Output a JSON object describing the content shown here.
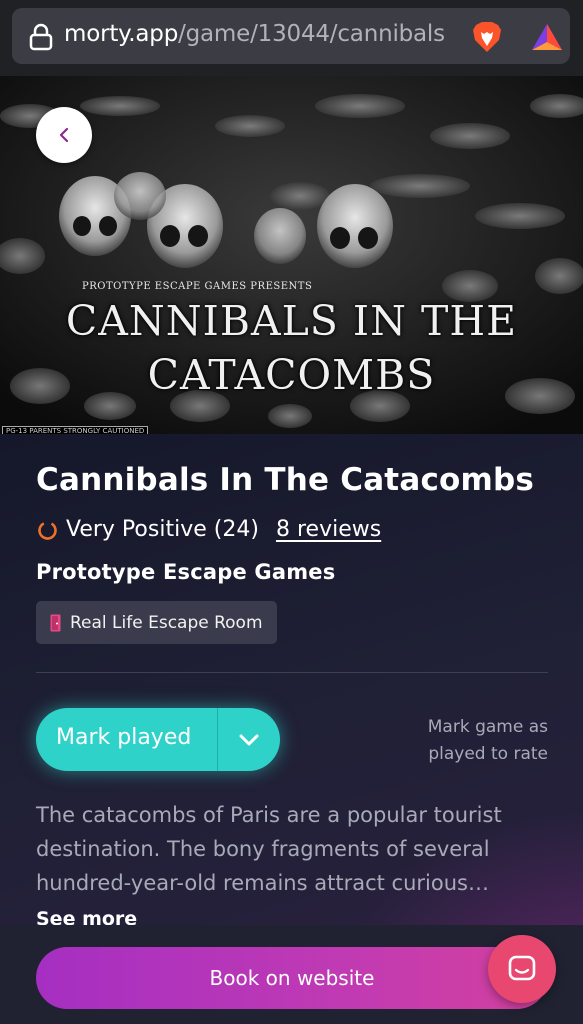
{
  "browser": {
    "url_host": "morty.app",
    "url_path": "/game/13044/cannibals"
  },
  "hero": {
    "poster_presents": "PROTOTYPE ESCAPE GAMES PRESENTS",
    "poster_title_line1": "CANNIBALS IN THE",
    "poster_title_line2": "CATACOMBS",
    "poster_rating": "PG-13 PARENTS STRONGLY CAUTIONED"
  },
  "game": {
    "title": "Cannibals In The Catacombs",
    "rating_text": "Very Positive (24)",
    "reviews_link": "8 reviews",
    "company": "Prototype Escape Games",
    "tag": "Real Life Escape Room"
  },
  "actions": {
    "mark_played": "Mark played",
    "mark_hint_line1": "Mark game as",
    "mark_hint_line2": "played to rate",
    "book": "Book on website"
  },
  "description": {
    "text": "The catacombs of Paris are a popular tourist destination. The bony fragments of several hundred-year-old remains attract curious…",
    "see_more": "See more"
  },
  "colors": {
    "accent_teal": "#2fd2c9",
    "accent_magenta": "#c03ab3",
    "rating_orange": "#f0702a",
    "chat_pink": "#e84870"
  },
  "icons": [
    "lock-icon",
    "brave-lion-icon",
    "triangle-rewards-icon",
    "back-chevron-icon",
    "rating-ring-icon",
    "door-icon",
    "chevron-down-icon",
    "chat-icon"
  ]
}
